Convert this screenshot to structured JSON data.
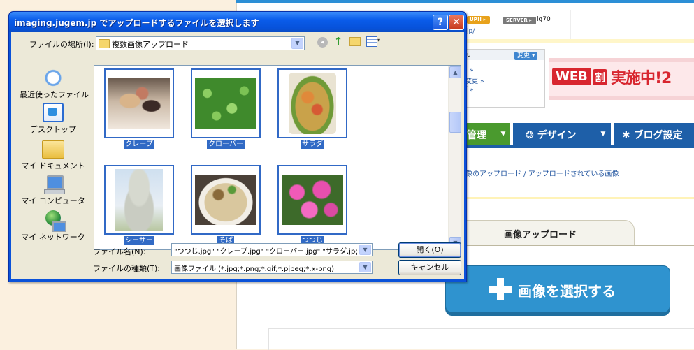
{
  "bg": {
    "badge_up": "UP!! ▸",
    "badge_server": "SERVER ▸",
    "server": "ig70",
    "url_fragment": "jp/",
    "panel_user": "u",
    "panel_change": "変更 ▾",
    "panel_link1": "»",
    "panel_link2": "- 変更 »",
    "panel_link3": "ブ »",
    "banner_web": "WEB",
    "banner_wari": "割",
    "banner_text": "実施中!2",
    "nav_manage": "管理",
    "nav_design": "デザイン",
    "nav_settings": "ブログ設定",
    "crumb1": "像のアップロード",
    "crumb_sep": " / ",
    "crumb2": "アップロードされている画像",
    "tab_upload": "画像アップロード",
    "select_button": "画像を選択する",
    "colors": {
      "nav_blue": "#1e5fa8",
      "nav_green": "#4a9a2e",
      "select_blue": "#2f93cf",
      "banner_red": "#d8262f"
    }
  },
  "dialog": {
    "title": "imaging.jugem.jp でアップロードするファイルを選択します",
    "help": "?",
    "close": "✕",
    "lookin_label": "ファイルの場所(I):",
    "lookin_value": "複数画像アップロード",
    "toolbar": {
      "back": "◂",
      "up": "↑",
      "newfolder": "new-folder-icon",
      "views": "▾"
    },
    "places": [
      {
        "label": "最近使ったファイル"
      },
      {
        "label": "デスクトップ"
      },
      {
        "label": "マイ ドキュメント"
      },
      {
        "label": "マイ コンピュータ"
      },
      {
        "label": "マイ ネットワーク"
      }
    ],
    "files": [
      {
        "name": "クレープ"
      },
      {
        "name": "クローバー"
      },
      {
        "name": "サラダ"
      },
      {
        "name": "シーサー"
      },
      {
        "name": "そば"
      },
      {
        "name": "つつじ"
      }
    ],
    "filename_label": "ファイル名(N):",
    "filename_value": "\"つつじ.jpg\" \"クレープ.jpg\" \"クローバー.jpg\" \"サラダ.jpg\"",
    "filetype_label": "ファイルの種類(T):",
    "filetype_value": "画像ファイル (*.jpg;*.png;*.gif;*.pjpeg;*.x-png)",
    "open_button": "開く(O)",
    "cancel_button": "キャンセル"
  }
}
